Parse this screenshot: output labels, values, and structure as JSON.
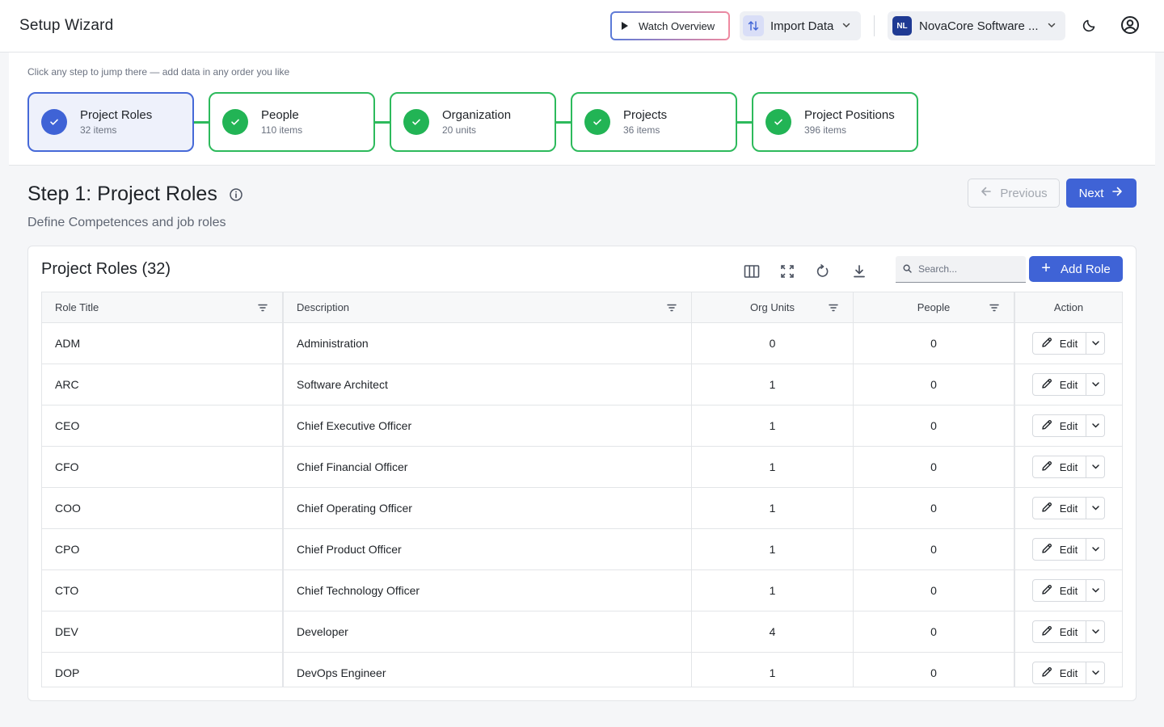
{
  "header": {
    "title": "Setup Wizard",
    "watch_label": "Watch Overview",
    "import_label": "Import Data",
    "org_initials": "NL",
    "org_name": "NovaCore Software ..."
  },
  "stepper": {
    "hint": "Click any step to jump there — add data in any order you like",
    "steps": [
      {
        "name": "Project Roles",
        "count": "32 items"
      },
      {
        "name": "People",
        "count": "110 items"
      },
      {
        "name": "Organization",
        "count": "20 units"
      },
      {
        "name": "Projects",
        "count": "36 items"
      },
      {
        "name": "Project Positions",
        "count": "396 items"
      }
    ]
  },
  "section": {
    "title": "Step 1: Project Roles",
    "subtitle": "Define Competences and job roles",
    "prev_label": "Previous",
    "next_label": "Next"
  },
  "card": {
    "title": "Project Roles (32)",
    "search_placeholder": "Search...",
    "add_label": "Add Role"
  },
  "table": {
    "columns": [
      "Role Title",
      "Description",
      "Org Units",
      "People",
      "Action"
    ],
    "edit_label": "Edit",
    "rows": [
      {
        "role": "ADM",
        "description": "Administration",
        "org_units": "0",
        "people": "0"
      },
      {
        "role": "ARC",
        "description": "Software Architect",
        "org_units": "1",
        "people": "0"
      },
      {
        "role": "CEO",
        "description": "Chief Executive Officer",
        "org_units": "1",
        "people": "0"
      },
      {
        "role": "CFO",
        "description": "Chief Financial Officer",
        "org_units": "1",
        "people": "0"
      },
      {
        "role": "COO",
        "description": "Chief Operating Officer",
        "org_units": "1",
        "people": "0"
      },
      {
        "role": "CPO",
        "description": "Chief Product Officer",
        "org_units": "1",
        "people": "0"
      },
      {
        "role": "CTO",
        "description": "Chief Technology Officer",
        "org_units": "1",
        "people": "0"
      },
      {
        "role": "DEV",
        "description": "Developer",
        "org_units": "4",
        "people": "0"
      },
      {
        "role": "DOP",
        "description": "DevOps Engineer",
        "org_units": "1",
        "people": "0"
      }
    ]
  },
  "colors": {
    "accent": "#3f63d6",
    "success": "#22b455"
  }
}
